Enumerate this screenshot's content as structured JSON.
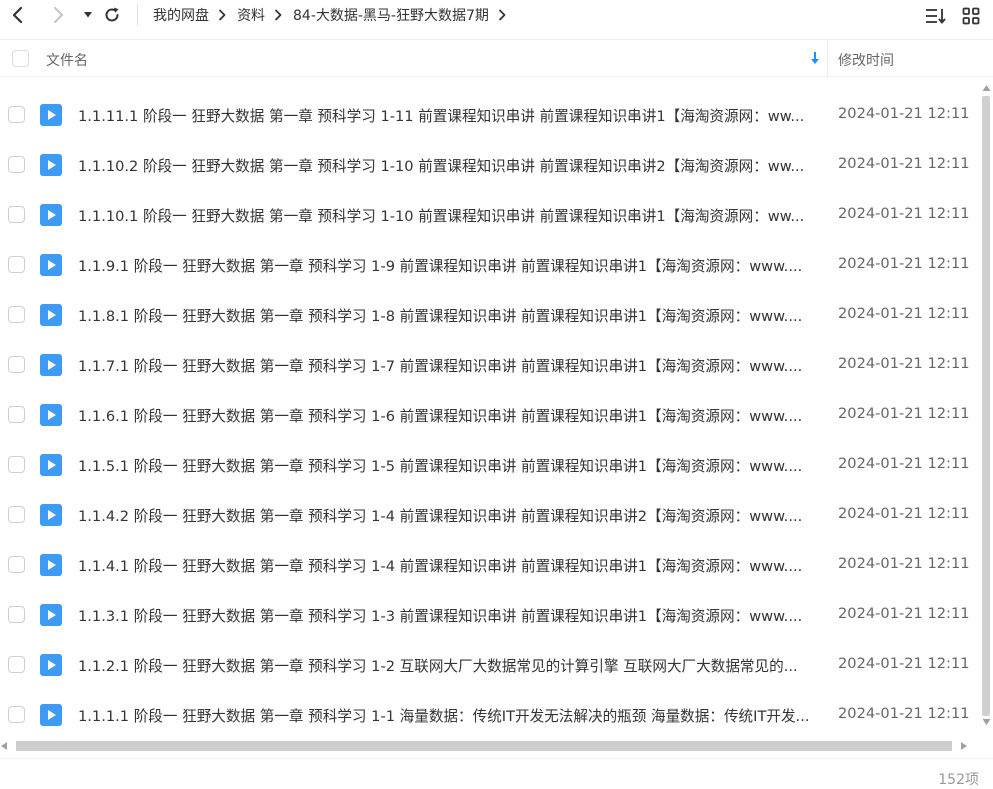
{
  "toolbar": {
    "breadcrumb": [
      "我的网盘",
      "资料",
      "84-大数据-黑马-狂野大数据7期"
    ]
  },
  "header": {
    "col_name": "文件名",
    "col_time": "修改时间",
    "sort_symbol": "↓"
  },
  "colors": {
    "file_icon": "#3d9af5",
    "sort_accent": "#1e90ff",
    "scroll_thumb": "#d0d0d0"
  },
  "files": [
    {
      "name": "1.1.11.1 阶段一 狂野大数据 第一章 预科学习 1-11 前置课程知识串讲 前置课程知识串讲1【海淘资源网：ww...",
      "time": "2024-01-21 12:11"
    },
    {
      "name": "1.1.10.2 阶段一 狂野大数据 第一章 预科学习 1-10 前置课程知识串讲 前置课程知识串讲2【海淘资源网：ww...",
      "time": "2024-01-21 12:11"
    },
    {
      "name": "1.1.10.1 阶段一 狂野大数据 第一章 预科学习 1-10 前置课程知识串讲 前置课程知识串讲1【海淘资源网：ww...",
      "time": "2024-01-21 12:11"
    },
    {
      "name": "1.1.9.1 阶段一 狂野大数据 第一章 预科学习 1-9 前置课程知识串讲 前置课程知识串讲1【海淘资源网：www....",
      "time": "2024-01-21 12:11"
    },
    {
      "name": "1.1.8.1 阶段一 狂野大数据 第一章 预科学习 1-8 前置课程知识串讲 前置课程知识串讲1【海淘资源网：www....",
      "time": "2024-01-21 12:11"
    },
    {
      "name": "1.1.7.1 阶段一 狂野大数据 第一章 预科学习 1-7 前置课程知识串讲 前置课程知识串讲1【海淘资源网：www....",
      "time": "2024-01-21 12:11"
    },
    {
      "name": "1.1.6.1 阶段一 狂野大数据 第一章 预科学习 1-6 前置课程知识串讲 前置课程知识串讲1【海淘资源网：www....",
      "time": "2024-01-21 12:11"
    },
    {
      "name": "1.1.5.1 阶段一 狂野大数据 第一章 预科学习 1-5 前置课程知识串讲 前置课程知识串讲1【海淘资源网：www....",
      "time": "2024-01-21 12:11"
    },
    {
      "name": "1.1.4.2 阶段一 狂野大数据 第一章 预科学习 1-4 前置课程知识串讲 前置课程知识串讲2【海淘资源网：www....",
      "time": "2024-01-21 12:11"
    },
    {
      "name": "1.1.4.1 阶段一 狂野大数据 第一章 预科学习 1-4 前置课程知识串讲 前置课程知识串讲1【海淘资源网：www....",
      "time": "2024-01-21 12:11"
    },
    {
      "name": "1.1.3.1 阶段一 狂野大数据 第一章 预科学习 1-3 前置课程知识串讲 前置课程知识串讲1【海淘资源网：www....",
      "time": "2024-01-21 12:11"
    },
    {
      "name": "1.1.2.1 阶段一 狂野大数据 第一章 预科学习 1-2 互联网大厂大数据常见的计算引擎 互联网大厂大数据常见的...",
      "time": "2024-01-21 12:11"
    },
    {
      "name": "1.1.1.1 阶段一 狂野大数据 第一章 预科学习 1-1 海量数据：传统IT开发无法解决的瓶颈 海量数据：传统IT开发...",
      "time": "2024-01-21 12:11"
    }
  ],
  "footer": {
    "item_count": "152项"
  }
}
